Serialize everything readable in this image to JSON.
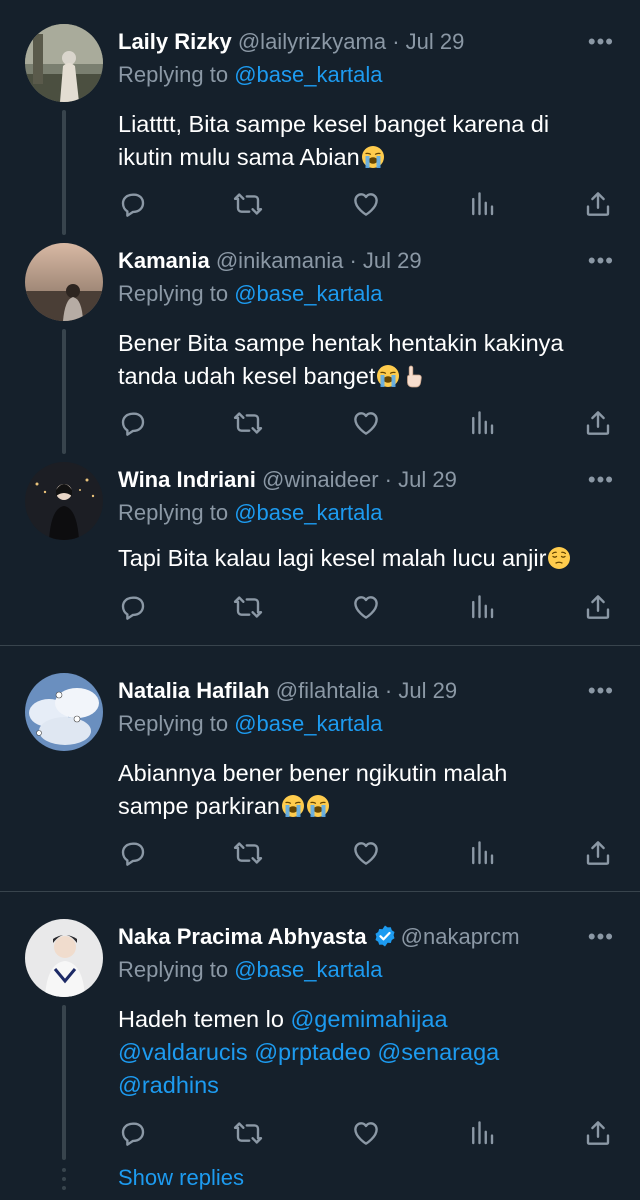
{
  "colors": {
    "background": "#15202b",
    "link": "#1d9bf0",
    "muted": "#8b98a5",
    "divider": "#38444d",
    "verified": "#1d9bf0"
  },
  "icons": {
    "reply": "speech-bubble-icon",
    "retweet": "retweet-arrows-icon",
    "like": "heart-icon",
    "analytics": "bar-chart-icon",
    "share": "upload-arrow-icon",
    "more": "ellipsis-icon"
  },
  "tweets": [
    {
      "name": "Laily Rizky",
      "handle": "@lailyrizkyama",
      "sep": "·",
      "date": "Jul 29",
      "more": "•••",
      "replying_prefix": "Replying to",
      "replying_to": "@base_kartala",
      "text_line1": "Liatttt, Bita sampe kesel banget karena di",
      "text_line2": "ikutin mulu sama Abian",
      "emojis": [
        "loudly-crying-face"
      ]
    },
    {
      "name": "Kamania",
      "handle": "@inikamania",
      "sep": "·",
      "date": "Jul 29",
      "more": "•••",
      "replying_prefix": "Replying to",
      "replying_to": "@base_kartala",
      "text_line1": "Bener Bita sampe hentak hentakin kakinya",
      "text_line2": "tanda udah kesel banget",
      "emojis": [
        "loudly-crying-face",
        "backhand-index-pointing-up"
      ]
    },
    {
      "name": "Wina Indriani",
      "handle": "@winaideer",
      "sep": "·",
      "date": "Jul 29",
      "more": "•••",
      "replying_prefix": "Replying to",
      "replying_to": "@base_kartala",
      "text_line1": "Tapi Bita kalau lagi kesel malah lucu anjir",
      "emojis": [
        "pensive-face"
      ]
    },
    {
      "name": "Natalia Hafilah",
      "handle": "@filahtalia",
      "sep": "·",
      "date": "Jul 29",
      "more": "•••",
      "replying_prefix": "Replying to",
      "replying_to": "@base_kartala",
      "text_line1": "Abiannya bener bener ngikutin malah",
      "text_line2": "sampe parkiran",
      "emojis": [
        "loudly-crying-face",
        "loudly-crying-face"
      ]
    },
    {
      "name": "Naka Pracima Abhyasta",
      "verified": true,
      "handle": "@nakaprcm",
      "more": "•••",
      "replying_prefix": "Replying to",
      "replying_to": "@base_kartala",
      "text_prefix": "Hadeh temen lo",
      "mentions": [
        "@gemimahijaa",
        "@valdarucis",
        "@prptadeo",
        "@senaraga",
        "@radhins"
      ]
    }
  ],
  "show_replies": "Show replies"
}
